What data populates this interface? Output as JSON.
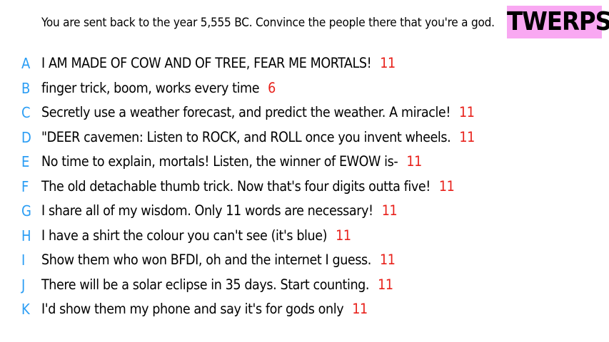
{
  "prompt": "You are sent back to the year 5,555 BC. Convince the people there that you're a god.",
  "logo": {
    "text": "TWERPS",
    "background": "#f9a8f2",
    "color": "#000000"
  },
  "colors": {
    "letter": "#2a9df4",
    "count": "#e8201a",
    "text": "#000000"
  },
  "responses": [
    {
      "letter": "A",
      "text": "I AM MADE OF COW AND OF TREE, FEAR ME MORTALS!",
      "count": "11"
    },
    {
      "letter": "B",
      "text": "finger trick, boom, works every time",
      "count": "6"
    },
    {
      "letter": "C",
      "text": "Secretly use a weather forecast, and predict the weather. A miracle!",
      "count": "11"
    },
    {
      "letter": "D",
      "text": "\"DEER cavemen: Listen to ROCK, and ROLL once you invent wheels.",
      "count": "11"
    },
    {
      "letter": "E",
      "text": "No time to explain, mortals! Listen, the winner of EWOW is-",
      "count": "11"
    },
    {
      "letter": "F",
      "text": "The old detachable thumb trick. Now that's four digits outta five!",
      "count": "11"
    },
    {
      "letter": "G",
      "text": "I share all of my wisdom. Only 11 words are necessary!",
      "count": "11"
    },
    {
      "letter": "H",
      "text": "I have a shirt the colour you can't see (it's blue)",
      "count": "11"
    },
    {
      "letter": "I",
      "text": "Show them who won BFDI, oh and the internet I guess.",
      "count": "11"
    },
    {
      "letter": "J",
      "text": "There will be a solar eclipse in 35 days. Start counting.",
      "count": "11"
    },
    {
      "letter": "K",
      "text": "I'd show them my phone and say it's for gods only",
      "count": "11"
    }
  ]
}
